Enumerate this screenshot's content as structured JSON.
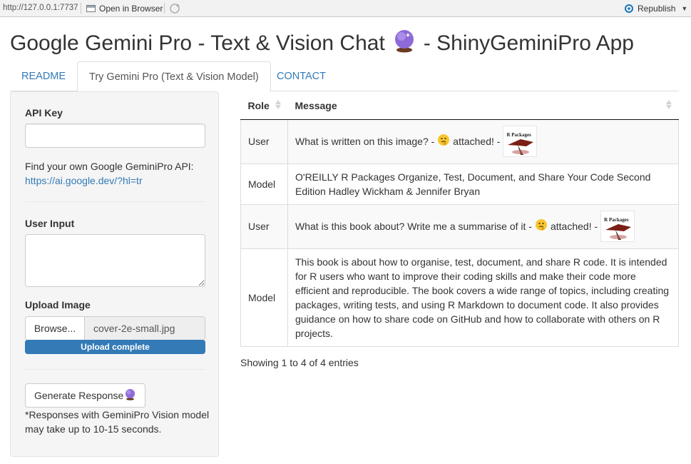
{
  "browser_bar": {
    "url": "http://127.0.0.1:7737",
    "open_in_browser": "Open in Browser",
    "republish": "Republish"
  },
  "header": {
    "title_part1": "Google Gemini Pro - Text & Vision Chat",
    "title_part2": "- ShinyGeminiPro App",
    "title_icon": "crystal-ball-icon"
  },
  "tabs": [
    {
      "label": "README",
      "active": false
    },
    {
      "label": "Try Gemini Pro (Text & Vision Model)",
      "active": true
    },
    {
      "label": "CONTACT",
      "active": false
    }
  ],
  "sidebar": {
    "api_key_label": "API Key",
    "api_key_value": "",
    "api_help_text": "Find your own Google GeminiPro API:",
    "api_help_link": "https://ai.google.dev/?hl=tr",
    "user_input_label": "User Input",
    "user_input_value": "",
    "upload_label": "Upload Image",
    "browse_label": "Browse...",
    "file_name": "cover-2e-small.jpg",
    "upload_status": "Upload complete",
    "upload_progress": 1.0,
    "generate_label": "Generate Response",
    "note": "*Responses with GeminiPro Vision model may take up to 10-15 seconds."
  },
  "table": {
    "headers": [
      "Role",
      "Message"
    ],
    "rows": [
      {
        "role": "User",
        "message": "What is written on this image? -",
        "suffix": "attached! -",
        "has_image": true
      },
      {
        "role": "Model",
        "message": "O'REILLY R Packages Organize, Test, Document, and Share Your Code Second Edition Hadley Wickham & Jennifer Bryan",
        "has_image": false
      },
      {
        "role": "User",
        "message": "What is this book about? Write me a summarise of it -",
        "suffix": "attached! -",
        "has_image": true
      },
      {
        "role": "Model",
        "message": "This book is about how to organise, test, document, and share R code. It is intended for R users who want to improve their coding skills and make their code more efficient and reproducible. The book covers a wide range of topics, including creating packages, writing tests, and using R Markdown to document code. It also provides guidance on how to share code on GitHub and how to collaborate with others on R projects.",
        "has_image": false
      }
    ],
    "thumbnail_title": "R Packages",
    "info": "Showing 1 to 4 of 4 entries"
  },
  "colors": {
    "link": "#337ab7",
    "progress": "#337ab7",
    "well_bg": "#f5f5f5"
  }
}
